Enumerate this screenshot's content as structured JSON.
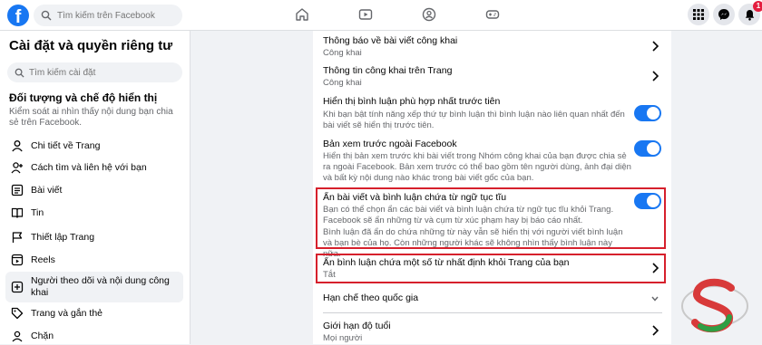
{
  "topbar": {
    "logo": "f",
    "search_placeholder": "Tìm kiếm trên Facebook",
    "notification_count": "1"
  },
  "sidebar": {
    "title": "Cài đặt và quyền riêng tư",
    "search_placeholder": "Tìm kiếm cài đặt",
    "section_title": "Đối tượng và chế độ hiển thị",
    "section_desc": "Kiểm soát ai nhìn thấy nội dung bạn chia sẻ trên Facebook.",
    "items": [
      {
        "label": "Chi tiết về Trang",
        "icon": "person-icon"
      },
      {
        "label": "Cách tìm và liên hệ với bạn",
        "icon": "person-add-icon"
      },
      {
        "label": "Bài viết",
        "icon": "post-icon"
      },
      {
        "label": "Tin",
        "icon": "book-icon"
      },
      {
        "label": "Thiết lập Trang",
        "icon": "flag-icon"
      },
      {
        "label": "Reels",
        "icon": "reels-icon"
      },
      {
        "label": "Người theo dõi và nội dung công khai",
        "icon": "plus-box-icon"
      },
      {
        "label": "Trang và gắn thẻ",
        "icon": "tag-icon"
      },
      {
        "label": "Chặn",
        "icon": "block-icon"
      }
    ]
  },
  "settings": [
    {
      "title": "Thông báo về bài viết công khai",
      "sub": "Công khai"
    },
    {
      "title": "Thông tin công khai trên Trang",
      "sub": "Công khai"
    },
    {
      "title": "Hiển thị bình luận phù hợp nhất trước tiên",
      "sub": "Khi bạn bật tính năng xếp thứ tự bình luận thì bình luận nào liên quan nhất đến bài viết sẽ hiển thị trước tiên."
    },
    {
      "title": "Bản xem trước ngoài Facebook",
      "sub": "Hiển thị bản xem trước khi bài viết trong Nhóm công khai của bạn được chia sẻ ra ngoài Facebook. Bản xem trước có thể bao gồm tên người dùng, ảnh đại diện và bất kỳ nội dung nào khác trong bài viết gốc của bạn."
    },
    {
      "title": "Ẩn bài viết và bình luận chứa từ ngữ tục tĩu",
      "sub": "Bạn có thể chọn ẩn các bài viết và bình luận chứa từ ngữ tục tĩu khỏi Trang. Facebook sẽ ẩn những từ và cụm từ xúc phạm hay bị báo cáo nhất.",
      "sub2": "Bình luận đã ẩn do chứa những từ này vẫn sẽ hiển thị với người viết bình luận và bạn bè của họ. Còn những người khác sẽ không nhìn thấy bình luận này nữa."
    },
    {
      "title": "Ẩn bình luận chứa một số từ nhất định khỏi Trang của bạn",
      "sub": "Tắt"
    },
    {
      "title": "Hạn chế theo quốc gia"
    },
    {
      "title": "Giới hạn độ tuổi",
      "sub": "Mọi người"
    }
  ],
  "colors": {
    "accent": "#1877f2",
    "highlight": "#d6202c"
  }
}
